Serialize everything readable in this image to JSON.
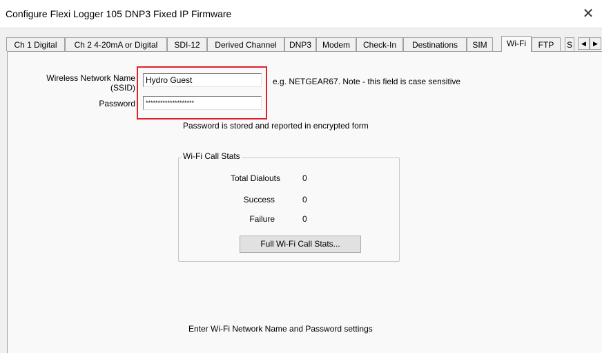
{
  "window": {
    "title": "Configure Flexi Logger 105 DNP3 Fixed IP Firmware",
    "close_glyph": "✕"
  },
  "tabs": [
    {
      "label": "Ch 1 Digital"
    },
    {
      "label": "Ch 2 4-20mA or Digital"
    },
    {
      "label": "SDI-12"
    },
    {
      "label": "Derived Channel"
    },
    {
      "label": "DNP3"
    },
    {
      "label": "Modem"
    },
    {
      "label": "Check-In"
    },
    {
      "label": "Destinations"
    },
    {
      "label": "SIM"
    },
    {
      "label": "Wi-Fi",
      "active": true
    },
    {
      "label": "FTP"
    },
    {
      "label": "S"
    }
  ],
  "tab_scroll": {
    "left_glyph": "◀",
    "right_glyph": "▶"
  },
  "wifi": {
    "ssid_label_line1": "Wireless Network Name",
    "ssid_label_line2": "(SSID)",
    "ssid_value": "Hydro Guest",
    "ssid_hint": "e.g. NETGEAR67.  Note - this field is case sensitive",
    "password_label": "Password",
    "password_value": "********************",
    "password_note": "Password is stored and reported in encrypted form"
  },
  "call_stats": {
    "group_title": "Wi-Fi Call Stats",
    "total_dialouts_label": "Total Dialouts",
    "total_dialouts_value": "0",
    "success_label": "Success",
    "success_value": "0",
    "failure_label": "Failure",
    "failure_value": "0",
    "full_stats_button": "Full Wi-Fi Call Stats..."
  },
  "footer_hint": "Enter Wi-Fi Network Name and Password settings",
  "colors": {
    "highlight": "#e0202a",
    "panel_bg": "#f9f9f9",
    "dialog_bg": "#f0f0f0"
  }
}
